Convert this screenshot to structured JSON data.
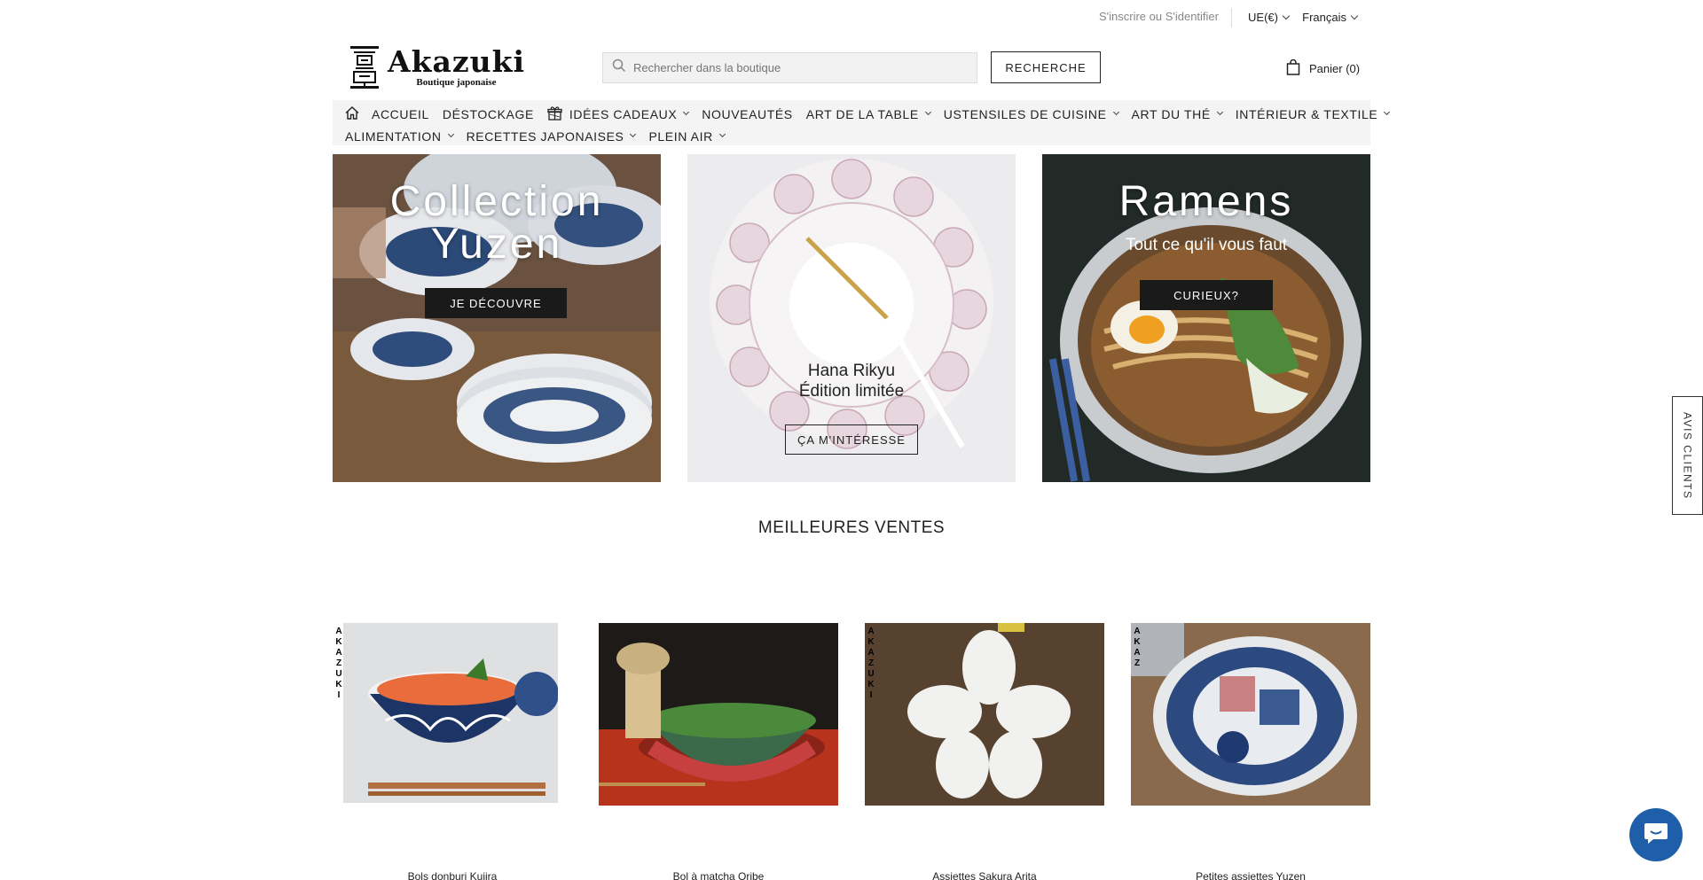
{
  "topbar": {
    "signin": "S'inscrire ou S'identifier",
    "currency": "UE(€)",
    "language": "Français"
  },
  "header": {
    "logo_name": "Akazuki",
    "logo_tagline": "Boutique japonaise",
    "search_placeholder": "Rechercher dans la boutique",
    "search_button": "RECHERCHE",
    "cart_label": "Panier (0)"
  },
  "nav": {
    "row1": [
      {
        "label": "ACCUEIL",
        "has_dropdown": false
      },
      {
        "label": "DÉSTOCKAGE",
        "has_dropdown": false
      },
      {
        "label": "IDÉES CADEAUX",
        "has_dropdown": true
      },
      {
        "label": "NOUVEAUTÉS",
        "has_dropdown": false
      },
      {
        "label": "ART DE LA TABLE",
        "has_dropdown": true
      },
      {
        "label": "USTENSILES DE CUISINE",
        "has_dropdown": true
      },
      {
        "label": "ART DU THÉ",
        "has_dropdown": true
      },
      {
        "label": "INTÉRIEUR & TEXTILE",
        "has_dropdown": true
      }
    ],
    "row2": [
      {
        "label": "ALIMENTATION",
        "has_dropdown": true
      },
      {
        "label": "RECETTES JAPONAISES",
        "has_dropdown": true
      },
      {
        "label": "PLEIN AIR",
        "has_dropdown": true
      }
    ]
  },
  "banners": [
    {
      "title": "Collection Yuzen",
      "button": "JE DÉCOUVRE"
    },
    {
      "title_line1": "Hana Rikyu",
      "title_line2": "Édition limitée",
      "button": "ÇA M'INTÉRESSE"
    },
    {
      "title": "Ramens",
      "subtitle": "Tout ce qu'il vous faut",
      "button": "CURIEUX?"
    }
  ],
  "bestsellers": {
    "title": "MEILLEURES VENTES",
    "products": [
      {
        "name": "Bols donburi Kujira",
        "brand_tag": "AKAZUKI"
      },
      {
        "name": "Bol à matcha Oribe",
        "brand_tag": ""
      },
      {
        "name": "Assiettes Sakura Arita",
        "brand_tag": "AKAZUKI"
      },
      {
        "name": "Petites assiettes Yuzen",
        "brand_tag": "AKAZ"
      }
    ]
  },
  "side_tab": "AVIS CLIENTS",
  "icons": {
    "home": "home-icon",
    "gift": "gift-icon",
    "search": "search-icon",
    "cart": "shopping-bag-icon",
    "chat": "chat-icon"
  },
  "colors": {
    "accent": "#1f5ea8",
    "nav_bg": "#f4f4f4",
    "button_dark": "#1a1a1a"
  }
}
